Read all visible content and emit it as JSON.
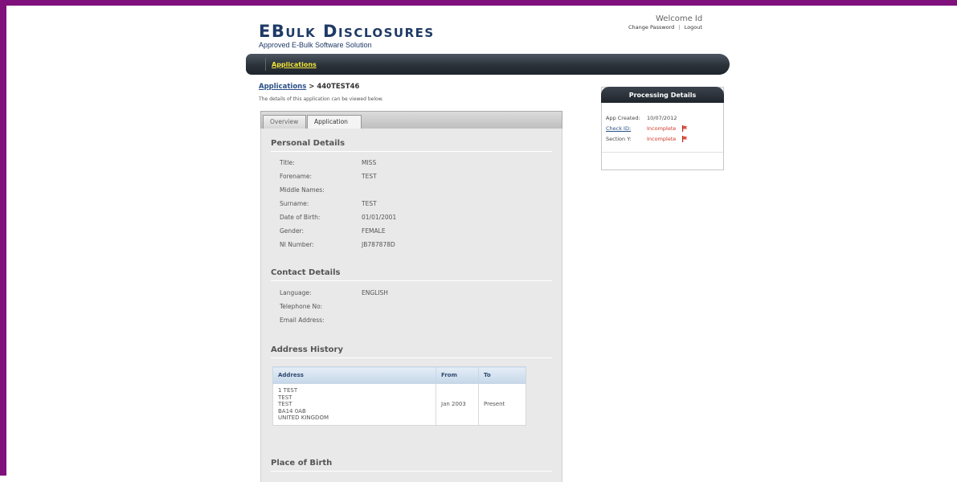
{
  "brand": {
    "title": "EBulk Disclosures",
    "subtitle": "Approved E-Bulk Software Solution"
  },
  "user": {
    "welcome": "Welcome Id",
    "change_password": "Change Password",
    "separator": "|",
    "logout": "Logout"
  },
  "nav": {
    "items": [
      {
        "label": "Applications"
      }
    ]
  },
  "breadcrumb": {
    "parent": "Applications",
    "separator": " > ",
    "current": "440TEST46"
  },
  "intro_text": "The details of this application can be viewed below.",
  "tabs": [
    {
      "label": "Overview",
      "active": false
    },
    {
      "label": "Application",
      "active": true
    }
  ],
  "personal_details": {
    "title": "Personal Details",
    "fields": [
      {
        "label": "Title:",
        "value": "MISS"
      },
      {
        "label": "Forename:",
        "value": "TEST"
      },
      {
        "label": "Middle Names:",
        "value": ""
      },
      {
        "label": "Surname:",
        "value": "TEST"
      },
      {
        "label": "Date of Birth:",
        "value": "01/01/2001"
      },
      {
        "label": "Gender:",
        "value": "FEMALE"
      },
      {
        "label": "NI Number:",
        "value": "JB787878D"
      }
    ]
  },
  "contact_details": {
    "title": "Contact Details",
    "fields": [
      {
        "label": "Language:",
        "value": "ENGLISH"
      },
      {
        "label": "Telephone No:",
        "value": ""
      },
      {
        "label": "Email Address:",
        "value": ""
      }
    ]
  },
  "address_history": {
    "title": "Address History",
    "columns": [
      "Address",
      "From",
      "To"
    ],
    "rows": [
      {
        "address_lines": [
          "1 TEST",
          "TEST",
          "TEST",
          "BA14 0AB",
          "UNITED KINGDOM"
        ],
        "from": "Jan 2003",
        "to": "Present"
      }
    ]
  },
  "place_of_birth": {
    "title": "Place of Birth"
  },
  "processing": {
    "title": "Processing Details",
    "rows": [
      {
        "label": "App Created:",
        "value": "10/07/2012",
        "status": "",
        "link": false
      },
      {
        "label": "Check ID:",
        "value": "Incomplete",
        "status": "incomplete",
        "link": true,
        "icon": "red-flag-icon"
      },
      {
        "label": "Section Y:",
        "value": "Incomplete",
        "status": "incomplete",
        "link": false,
        "icon": "red-flag-icon"
      }
    ]
  },
  "colors": {
    "frame": "#80107c",
    "brand": "#1f3a66",
    "nav_link": "#f2e63a",
    "incomplete": "#d0382a"
  }
}
